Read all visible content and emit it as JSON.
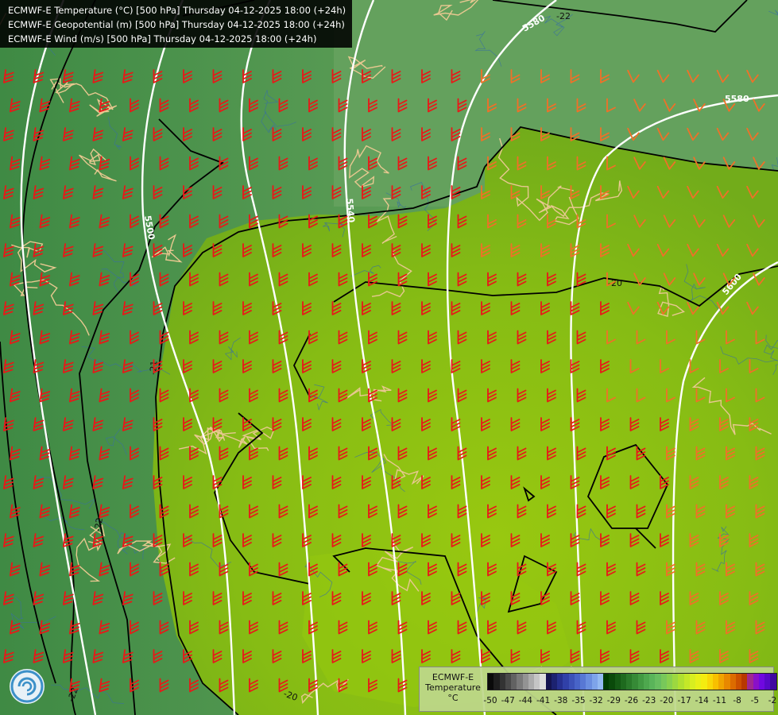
{
  "title_lines": [
    "ECMWF-E Temperature (°C) [500 hPa] Thursday 04-12-2025 18:00 (+24h)",
    "ECMWF-E Geopotential (m) [500 hPa] Thursday 04-12-2025 18:00 (+24h)",
    "ECMWF-E Wind (m/s) [500 hPa] Thursday 04-12-2025 18:00 (+24h)"
  ],
  "geopotential_labels": [
    "5500",
    "5540",
    "5580",
    "5600",
    "5580"
  ],
  "temperature_labels": [
    "-22",
    "-21",
    "-20",
    "-22",
    "-20",
    "-22"
  ],
  "legend": {
    "model": "ECMWF-E",
    "variable": "Temperature",
    "unit": "°C",
    "ticks": [
      "-50",
      "-47",
      "-44",
      "-41",
      "-38",
      "-35",
      "-32",
      "-29",
      "-26",
      "-23",
      "-20",
      "-17",
      "-14",
      "-11",
      "-8",
      "-5",
      "-2"
    ],
    "colors": [
      "#0a0a0a",
      "#1e1e1e",
      "#333333",
      "#4a4a4a",
      "#626262",
      "#7a7a7a",
      "#939393",
      "#acacac",
      "#c5c5c5",
      "#dedede",
      "#141450",
      "#1c2270",
      "#263090",
      "#3040a8",
      "#3c52b8",
      "#4864c8",
      "#5878d4",
      "#6a8ee0",
      "#7ea4ea",
      "#94baf2",
      "#003c00",
      "#0a4a0a",
      "#145a14",
      "#1e6a1e",
      "#2a7a2a",
      "#368a36",
      "#429a42",
      "#4ea84e",
      "#5ab45a",
      "#68be60",
      "#78c85a",
      "#88d04e",
      "#9cd840",
      "#b0e030",
      "#c4e828",
      "#d8ee20",
      "#e8f018",
      "#f4ec10",
      "#f8d808",
      "#f8c000",
      "#f0a400",
      "#e88800",
      "#dc6c00",
      "#cc5000",
      "#b83800",
      "#a02890",
      "#8a10c8",
      "#7008e0",
      "#5808c8",
      "#4008a0"
    ]
  },
  "colors": {
    "cold_region": "#5c9e55",
    "warm_region": "#84bb18",
    "wind_barb_strong": "#e81818",
    "wind_barb_weak": "#f07028",
    "geopotential_contour": "#ffffff",
    "temperature_contour": "#000000",
    "borders": "#e8c890",
    "rivers": "#3a70a0"
  },
  "icons": [
    "ecmwf-logo-icon",
    "wind-barb-icon"
  ]
}
